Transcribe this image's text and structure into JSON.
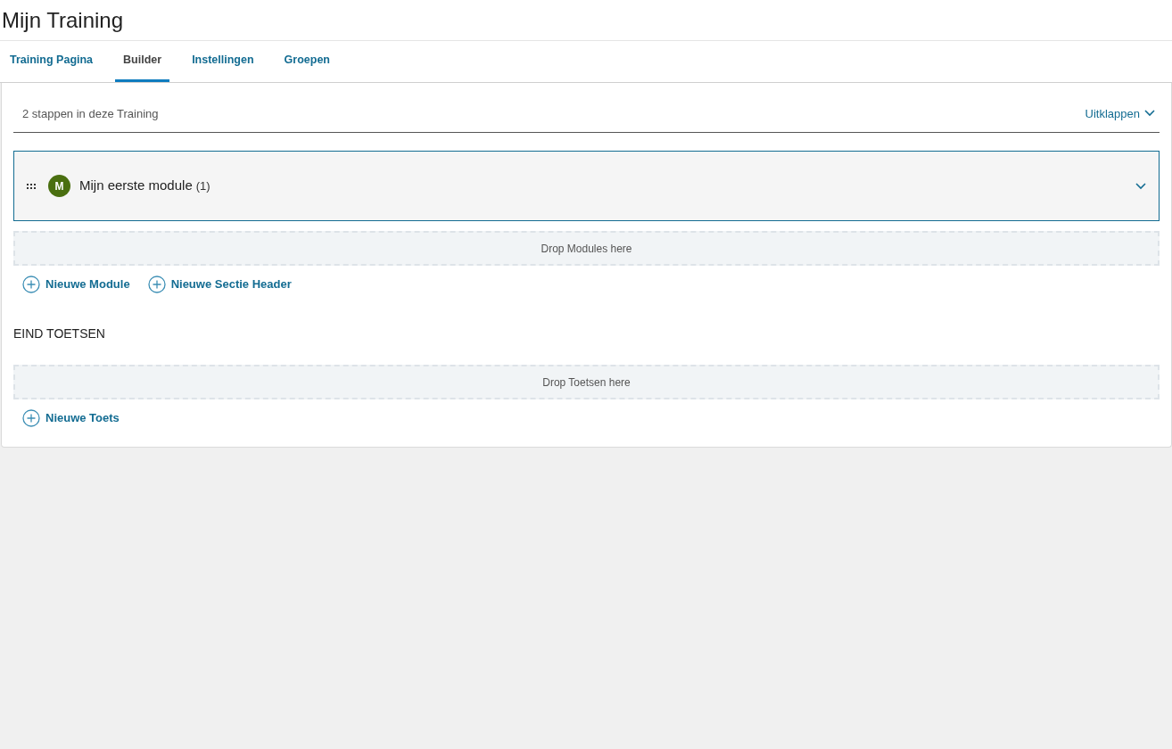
{
  "page_title": "Mijn Training",
  "tabs": [
    {
      "label": "Training Pagina",
      "selected": false
    },
    {
      "label": "Builder",
      "selected": true
    },
    {
      "label": "Instellingen",
      "selected": false
    },
    {
      "label": "Groepen",
      "selected": false
    }
  ],
  "builder": {
    "step_count": "2 stappen in deze Training",
    "expand_link": "Uitklappen",
    "modules": [
      {
        "avatar": "M",
        "title": "Mijn eerste module",
        "count": "(1)",
        "expanded": false
      }
    ],
    "module_drop_zone": "Drop Modules here",
    "module_actions": [
      "Nieuwe Module",
      "Nieuwe Sectie Header"
    ],
    "final_tests_heading": "EIND TOETSEN",
    "tests_drop_zone": "Drop Toetsen here",
    "test_actions": [
      "Nieuwe Toets"
    ]
  }
}
